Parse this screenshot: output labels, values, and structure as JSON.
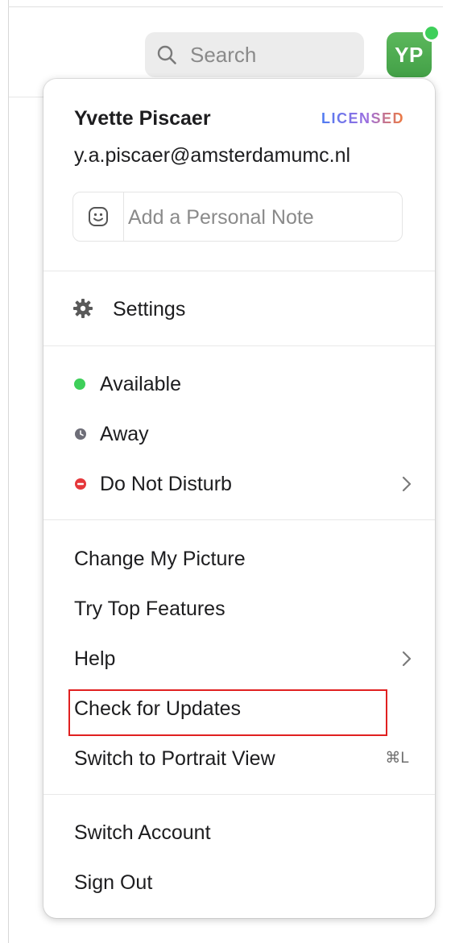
{
  "header": {
    "search_label": "Search",
    "avatar_initials": "YP"
  },
  "profile": {
    "name": "Yvette Piscaer",
    "license": "LICENSED",
    "email": "y.a.piscaer@amsterdamumc.nl",
    "note_placeholder": "Add a Personal Note"
  },
  "settings": {
    "label": "Settings"
  },
  "status": {
    "items": [
      {
        "label": "Available",
        "color": "#3ecf5a"
      },
      {
        "label": "Away",
        "color": "#6e6e78"
      },
      {
        "label": "Do Not Disturb",
        "color": "#e5383b"
      }
    ]
  },
  "actions": {
    "items": [
      {
        "label": "Change My Picture"
      },
      {
        "label": "Try Top Features"
      },
      {
        "label": "Help"
      },
      {
        "label": "Check for Updates"
      },
      {
        "label": "Switch to Portrait View",
        "shortcut": "⌘L"
      }
    ]
  },
  "account": {
    "items": [
      {
        "label": "Switch Account"
      },
      {
        "label": "Sign Out"
      }
    ]
  },
  "colors": {
    "avatar": "#4caf50",
    "highlight": "#e02020"
  }
}
